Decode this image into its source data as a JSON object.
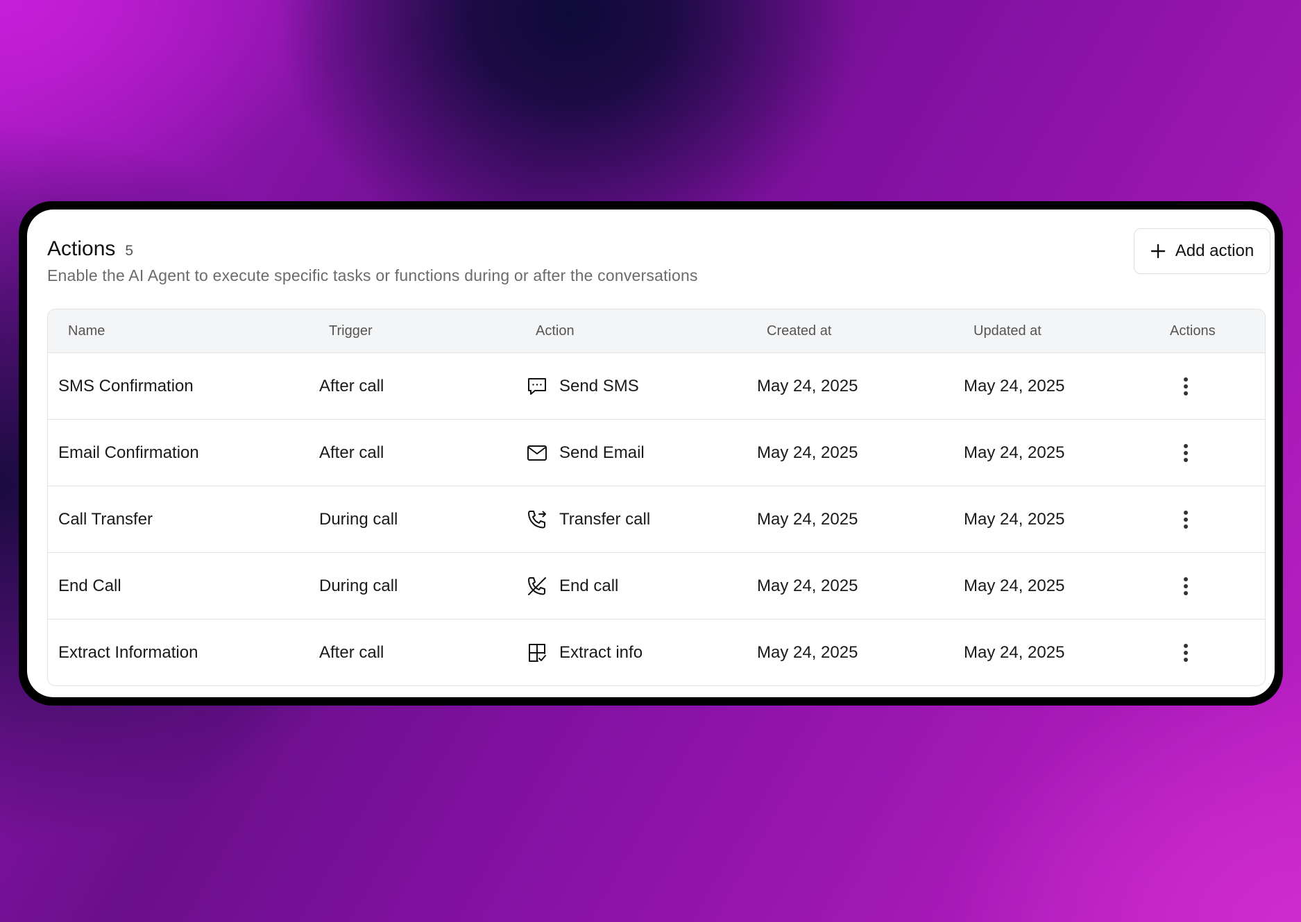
{
  "header": {
    "title": "Actions",
    "count": "5",
    "subtitle": "Enable the AI Agent to execute specific tasks or functions during or after the conversations",
    "add_button_label": "Add action",
    "add_button_icon": "plus-icon"
  },
  "table": {
    "columns": {
      "name": "Name",
      "trigger": "Trigger",
      "action": "Action",
      "created": "Created at",
      "updated": "Updated at",
      "actions": "Actions"
    },
    "rows": [
      {
        "name": "SMS Confirmation",
        "trigger": "After call",
        "action_label": "Send SMS",
        "action_icon": "message-bubble-icon",
        "created": "May 24, 2025",
        "updated": "May 24, 2025",
        "menu_icon": "more-vertical-icon"
      },
      {
        "name": "Email Confirmation",
        "trigger": "After call",
        "action_label": "Send Email",
        "action_icon": "envelope-icon",
        "created": "May 24, 2025",
        "updated": "May 24, 2025",
        "menu_icon": "more-vertical-icon"
      },
      {
        "name": "Call Transfer",
        "trigger": "During call",
        "action_label": "Transfer call",
        "action_icon": "phone-forward-icon",
        "created": "May 24, 2025",
        "updated": "May 24, 2025",
        "menu_icon": "more-vertical-icon"
      },
      {
        "name": "End Call",
        "trigger": "During call",
        "action_label": "End call",
        "action_icon": "phone-off-icon",
        "created": "May 24, 2025",
        "updated": "May 24, 2025",
        "menu_icon": "more-vertical-icon"
      },
      {
        "name": "Extract Information",
        "trigger": "After call",
        "action_label": "Extract info",
        "action_icon": "table-check-icon",
        "created": "May 24, 2025",
        "updated": "May 24, 2025",
        "menu_icon": "more-vertical-icon"
      }
    ]
  }
}
